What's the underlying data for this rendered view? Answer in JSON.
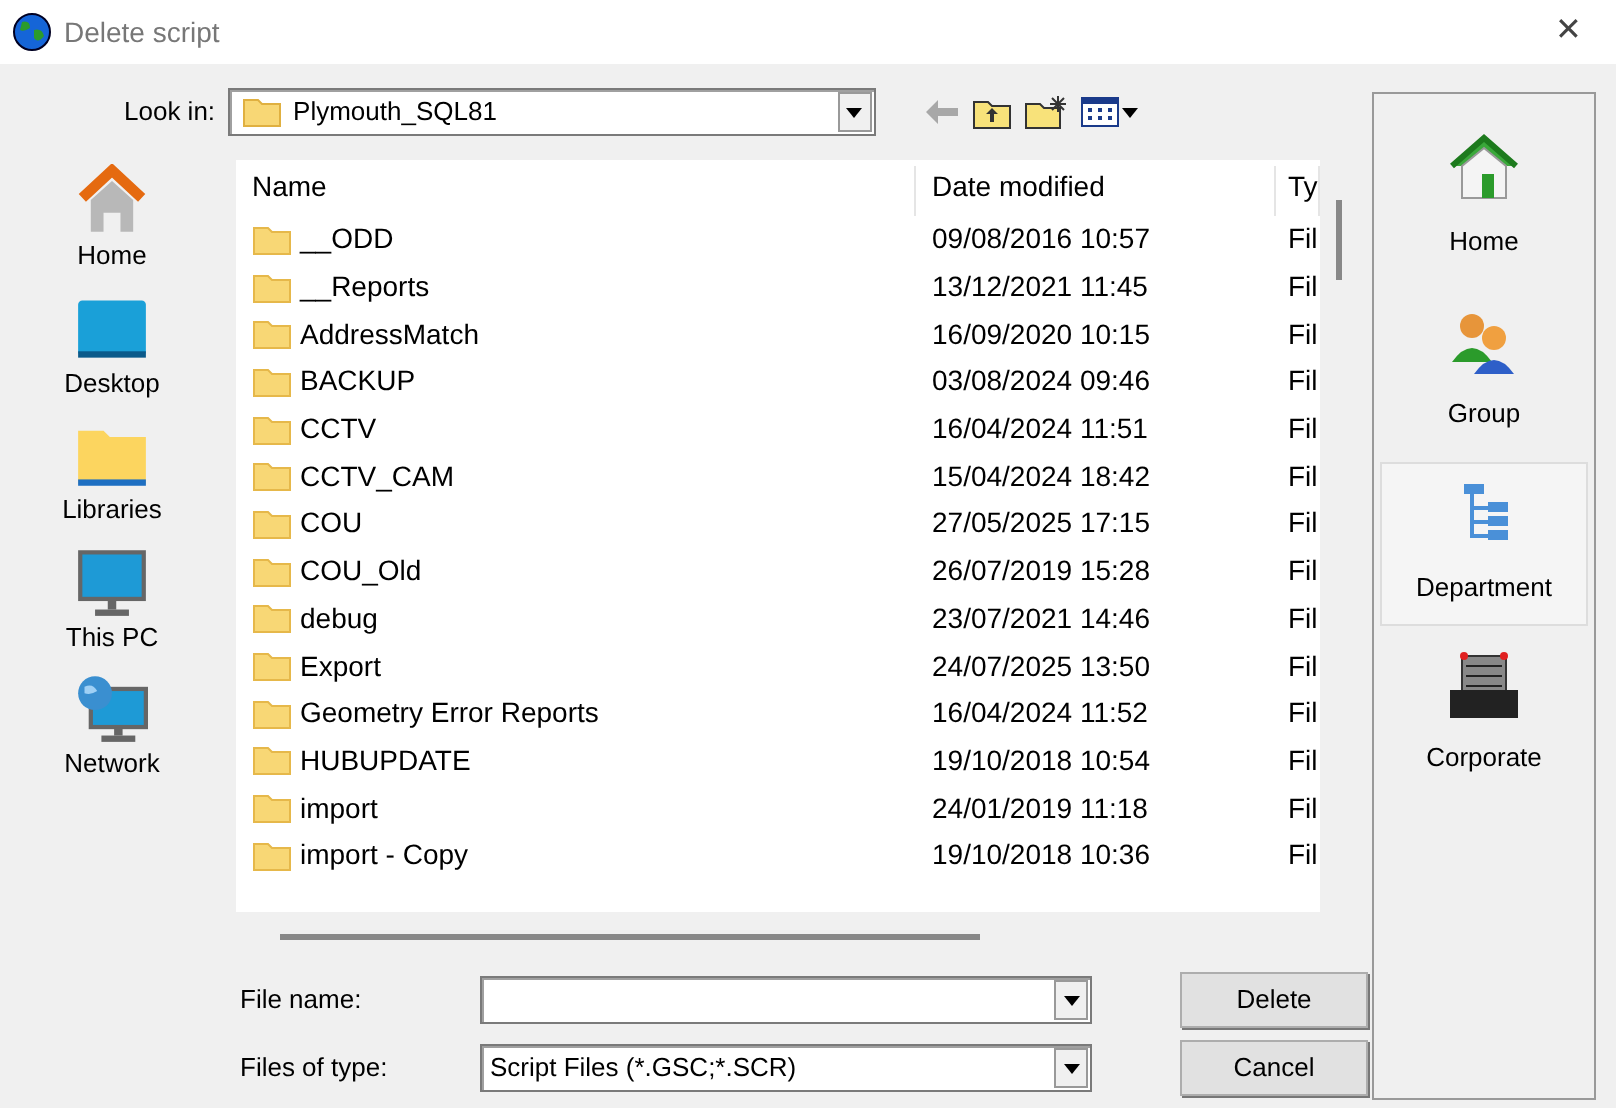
{
  "window": {
    "title": "Delete script",
    "close": "✕"
  },
  "look_in": {
    "label": "Look in:",
    "value": "Plymouth_SQL81"
  },
  "places": [
    {
      "label": "Home",
      "kind": "home"
    },
    {
      "label": "Desktop",
      "kind": "desktop"
    },
    {
      "label": "Libraries",
      "kind": "libraries"
    },
    {
      "label": "This PC",
      "kind": "pc"
    },
    {
      "label": "Network",
      "kind": "network"
    }
  ],
  "table": {
    "columns": [
      "Name",
      "Date modified",
      "Ty"
    ],
    "rows": [
      {
        "name": "__ODD",
        "date": "09/08/2016 10:57",
        "type": "Fil"
      },
      {
        "name": "__Reports",
        "date": "13/12/2021 11:45",
        "type": "Fil"
      },
      {
        "name": "AddressMatch",
        "date": "16/09/2020 10:15",
        "type": "Fil"
      },
      {
        "name": "BACKUP",
        "date": "03/08/2024 09:46",
        "type": "Fil"
      },
      {
        "name": "CCTV",
        "date": "16/04/2024 11:51",
        "type": "Fil"
      },
      {
        "name": "CCTV_CAM",
        "date": "15/04/2024 18:42",
        "type": "Fil"
      },
      {
        "name": "COU",
        "date": "27/05/2025 17:15",
        "type": "Fil"
      },
      {
        "name": "COU_Old",
        "date": "26/07/2019 15:28",
        "type": "Fil"
      },
      {
        "name": "debug",
        "date": "23/07/2021 14:46",
        "type": "Fil"
      },
      {
        "name": "Export",
        "date": "24/07/2025 13:50",
        "type": "Fil"
      },
      {
        "name": "Geometry Error Reports",
        "date": "16/04/2024 11:52",
        "type": "Fil"
      },
      {
        "name": "HUBUPDATE",
        "date": "19/10/2018 10:54",
        "type": "Fil"
      },
      {
        "name": "import",
        "date": "24/01/2019 11:18",
        "type": "Fil"
      },
      {
        "name": "import - Copy",
        "date": "19/10/2018 10:36",
        "type": "Fil"
      }
    ]
  },
  "file_name": {
    "label": "File name:"
  },
  "file_type": {
    "label": "Files of type:",
    "value": "Script Files (*.GSC;*.SCR)"
  },
  "buttons": [
    "Delete",
    "Cancel"
  ],
  "scopes": [
    {
      "label": "Home",
      "kind": "home",
      "selected": false
    },
    {
      "label": "Group",
      "kind": "group",
      "selected": false
    },
    {
      "label": "Department",
      "kind": "department",
      "selected": true
    },
    {
      "label": "Corporate",
      "kind": "corporate",
      "selected": false
    }
  ]
}
